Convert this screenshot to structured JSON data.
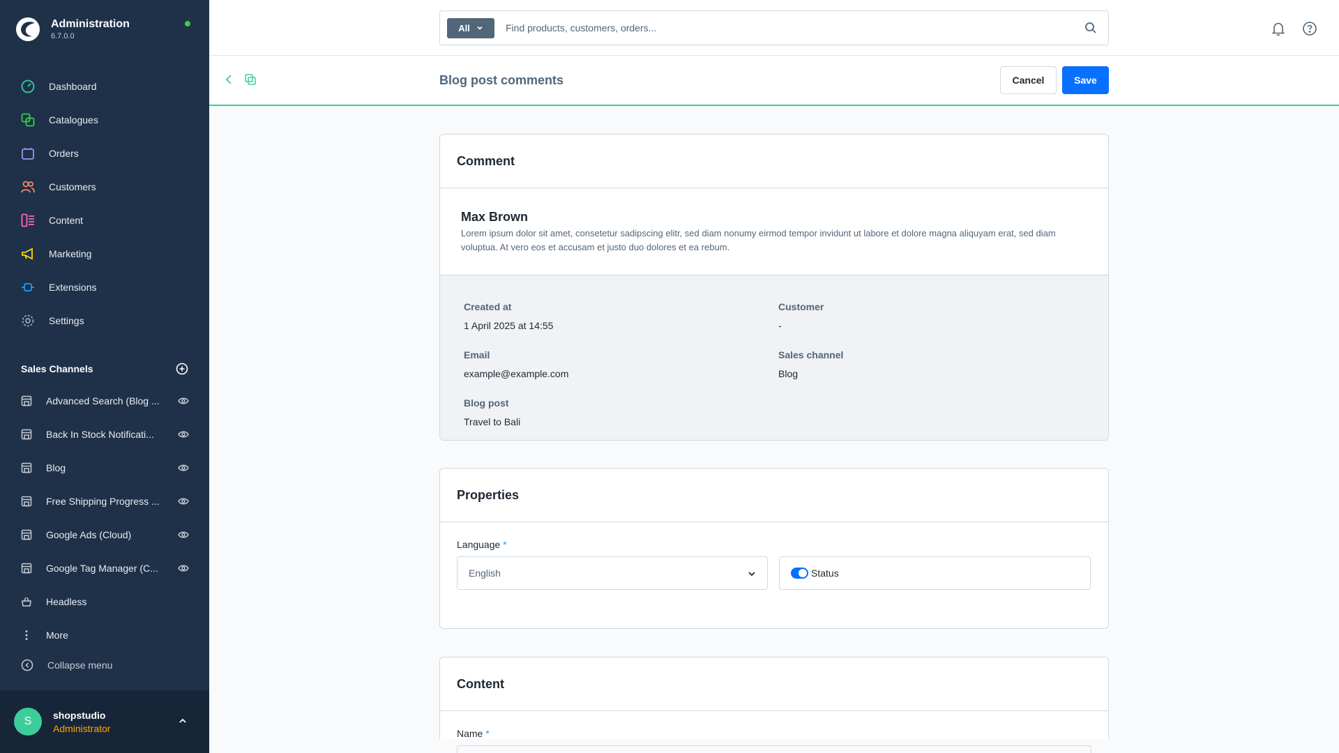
{
  "app": {
    "title": "Administration",
    "version": "6.7.0.0",
    "status_color": "#37d046",
    "brand_color": "#1f3149"
  },
  "sidebar": {
    "nav": [
      {
        "label": "Dashboard",
        "icon": "dashboard-icon",
        "color": "#3dcd9b"
      },
      {
        "label": "Catalogues",
        "icon": "catalogue-icon",
        "color": "#37d046"
      },
      {
        "label": "Orders",
        "icon": "orders-icon",
        "color": "#a092f0"
      },
      {
        "label": "Customers",
        "icon": "customers-icon",
        "color": "#f88962"
      },
      {
        "label": "Content",
        "icon": "content-icon",
        "color": "#ff68b4"
      },
      {
        "label": "Marketing",
        "icon": "marketing-icon",
        "color": "#ffd700"
      },
      {
        "label": "Extensions",
        "icon": "extensions-icon",
        "color": "#189eff"
      },
      {
        "label": "Settings",
        "icon": "settings-icon",
        "color": "#9aa8b5"
      }
    ],
    "sales_channels_title": "Sales Channels",
    "sales_channels": [
      {
        "label": "Advanced Search (Blog ...",
        "icon": "storefront-icon"
      },
      {
        "label": "Back In Stock Notificati...",
        "icon": "storefront-icon"
      },
      {
        "label": "Blog",
        "icon": "storefront-icon"
      },
      {
        "label": "Free Shipping Progress ...",
        "icon": "storefront-icon"
      },
      {
        "label": "Google Ads (Cloud)",
        "icon": "storefront-icon"
      },
      {
        "label": "Google Tag Manager (C...",
        "icon": "storefront-icon"
      },
      {
        "label": "Headless",
        "icon": "headless-icon"
      },
      {
        "label": "More",
        "icon": "more-icon"
      }
    ],
    "collapse_label": "Collapse menu",
    "user": {
      "initial": "S",
      "name": "shopstudio",
      "role": "Administrator"
    }
  },
  "search": {
    "type_label": "All",
    "placeholder": "Find products, customers, orders..."
  },
  "smartbar": {
    "title": "Blog post comments",
    "cancel_label": "Cancel",
    "save_label": "Save"
  },
  "comment_card": {
    "title": "Comment",
    "author": "Max Brown",
    "text": "Lorem ipsum dolor sit amet, consetetur sadipscing elitr, sed diam nonumy eirmod tempor invidunt ut labore et dolore magna aliquyam erat, sed diam voluptua. At vero eos et accusam et justo duo dolores et ea rebum.",
    "meta": {
      "created_label": "Created at",
      "created_value": "1 April 2025 at 14:55",
      "customer_label": "Customer",
      "customer_value": "-",
      "email_label": "Email",
      "email_value": "example@example.com",
      "channel_label": "Sales channel",
      "channel_value": "Blog",
      "post_label": "Blog post",
      "post_value": "Travel to Bali"
    }
  },
  "properties_card": {
    "title": "Properties",
    "language_label": "Language",
    "required_mark": "*",
    "language_value": "English",
    "status_label": "Status",
    "status_on": true
  },
  "content_card": {
    "title": "Content",
    "name_label": "Name",
    "required_mark": "*"
  }
}
